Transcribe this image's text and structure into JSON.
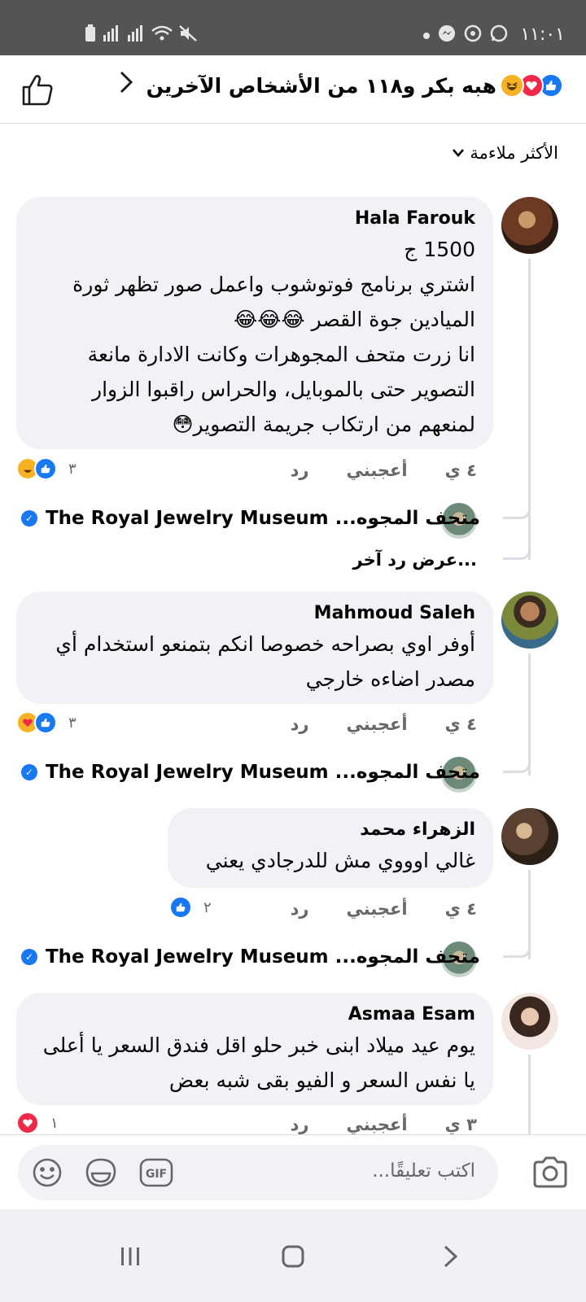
{
  "status_bar": {
    "time": "١١:٠١"
  },
  "header": {
    "title": "هبه بكر و١١٨ من الأشخاص الآخرين",
    "reactions": [
      "like-icon",
      "love-icon",
      "haha-icon"
    ]
  },
  "sort": {
    "label": "الأكثر ملاءمة"
  },
  "comments": [
    {
      "name": "Hala Farouk",
      "text": "1500 ج\nاشتري برنامج فوتوشوب واعمل صور تظهر  ثورة الميادين جوة القصر  😂😂😂\nانا زرت متحف المجوهرات وكانت الادارة مانعة التصوير حتى بالموبايل، والحراس راقبوا الزوار لمنعهم من ارتكاب جريمة التصوير😳",
      "time": "٤ ي",
      "like": "أعجبني",
      "reply": "رد",
      "reaction_count": "٣",
      "reply_preview": "متحف المجوه... The Royal Jewelry Museum",
      "more_replies": "عرض رد آخر..."
    },
    {
      "name": "Mahmoud Saleh",
      "text": "أوفر اوي بصراحه خصوصا انكم بتمنعو استخدام أي مصدر اضاءه خارجي",
      "time": "٤ ي",
      "like": "أعجبني",
      "reply": "رد",
      "reaction_count": "٣",
      "reply_preview": "متحف المجوه... The Royal Jewelry Museum"
    },
    {
      "name": "الزهراء محمد",
      "text": "غالي اوووي مش للدرجادي يعني",
      "time": "٤ ي",
      "like": "أعجبني",
      "reply": "رد",
      "reaction_count": "٢",
      "reply_preview": "متحف المجوه... The Royal Jewelry Museum"
    },
    {
      "name": "Asmaa Esam",
      "text": "يوم عيد ميلاد ابنى خبر حلو اقل فندق السعر  يا أعلى يا نفس السعر و الفيو بقى شبه بعض",
      "time": "٣ ي",
      "like": "أعجبني",
      "reply": "رد",
      "reaction_count": "١"
    }
  ],
  "composer": {
    "placeholder": "اكتب تعليقًا...",
    "gif_label": "GIF"
  },
  "colors": {
    "accent": "#1877f2",
    "bubble": "#f0f2f5",
    "love": "#f02849"
  }
}
